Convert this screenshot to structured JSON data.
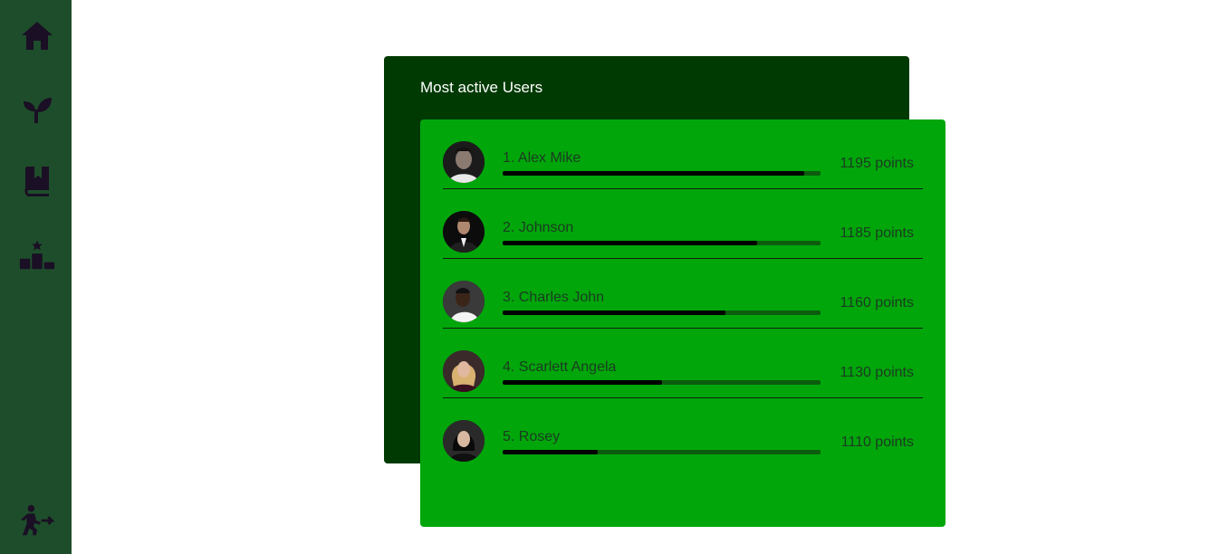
{
  "sidebar": {
    "items": [
      {
        "icon": "home-icon"
      },
      {
        "icon": "sprout-icon"
      },
      {
        "icon": "book-bookmark-icon"
      },
      {
        "icon": "leaderboard-icon"
      }
    ],
    "bottom_icon": "exit-icon"
  },
  "colors": {
    "sidebar": "#1e4d2b",
    "back_card": "#003a03",
    "front_card": "#00a60a",
    "bar_fill": "#000000",
    "bar_track": "#0c5c0e"
  },
  "leaderboard": {
    "title": "Most active Users",
    "users": [
      {
        "rank_name": "1.  Alex Mike",
        "points": "1195 points",
        "progress": 0.95
      },
      {
        "rank_name": "2. Johnson",
        "points": "1185 points",
        "progress": 0.8
      },
      {
        "rank_name": "3. Charles John",
        "points": "1160 points",
        "progress": 0.7
      },
      {
        "rank_name": "4. Scarlett Angela",
        "points": "1130 points",
        "progress": 0.5
      },
      {
        "rank_name": "5. Rosey",
        "points": "1110 points",
        "progress": 0.3
      }
    ]
  }
}
